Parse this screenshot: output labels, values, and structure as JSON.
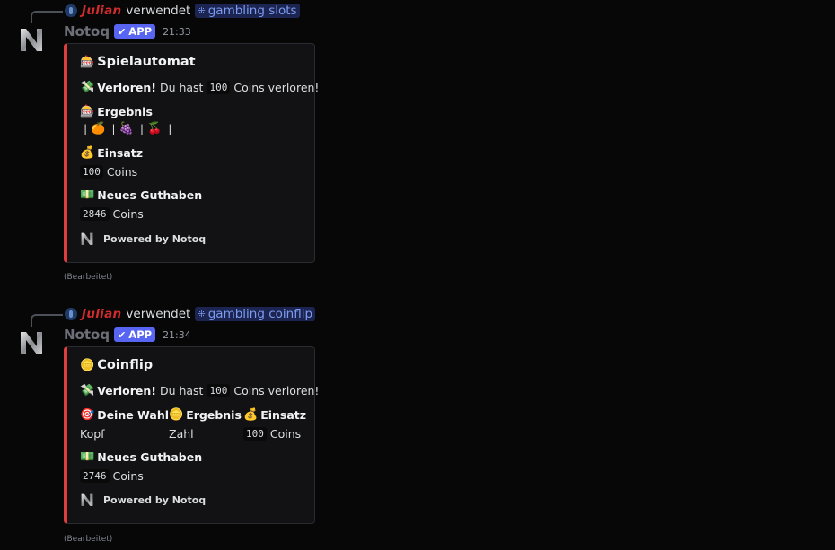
{
  "messages": [
    {
      "reply": {
        "user": "Julian",
        "verb": "verwendet",
        "command": "gambling slots"
      },
      "author": {
        "name": "Notoq",
        "tag": "APP",
        "time": "21:33"
      },
      "embed": {
        "accent": "#e03e3e",
        "title": "Spielautomat",
        "title_emoji": "🎰",
        "result_emoji": "💸",
        "result_bold": "Verloren!",
        "result_pre": "Du hast",
        "result_amount": "100",
        "result_post": "Coins verloren!",
        "fields": [
          {
            "emoji": "🎰",
            "name": "Ergebnis",
            "symbols": [
              "🍊",
              "🍇",
              "🍒"
            ]
          },
          {
            "emoji": "💰",
            "name": "Einsatz",
            "amount": "100",
            "unit": "Coins"
          },
          {
            "emoji": "💵",
            "name": "Neues Guthaben",
            "amount": "2846",
            "unit": "Coins"
          }
        ],
        "footer": "Powered by Notoq"
      },
      "edited": "(Bearbeitet)"
    },
    {
      "reply": {
        "user": "Julian",
        "verb": "verwendet",
        "command": "gambling coinflip"
      },
      "author": {
        "name": "Notoq",
        "tag": "APP",
        "time": "21:34"
      },
      "embed": {
        "accent": "#e03e3e",
        "title": "Coinflip",
        "title_emoji": "🪙",
        "result_emoji": "💸",
        "result_bold": "Verloren!",
        "result_pre": "Du hast",
        "result_amount": "100",
        "result_post": "Coins verloren!",
        "fields": [
          {
            "emoji": "🎯",
            "name": "Deine Wahl",
            "value": "Kopf"
          },
          {
            "emoji": "🪙",
            "name": "Ergebnis",
            "value": "Zahl"
          },
          {
            "emoji": "💰",
            "name": "Einsatz",
            "amount": "100",
            "unit": "Coins"
          },
          {
            "emoji": "💵",
            "name": "Neues Guthaben",
            "amount": "2746",
            "unit": "Coins"
          }
        ],
        "footer": "Powered by Notoq"
      },
      "edited": "(Bearbeitet)"
    }
  ],
  "icons": {
    "avatar": "notoq-n-logo",
    "command": "slash-command-icon",
    "app_check": "checkmark-icon"
  }
}
